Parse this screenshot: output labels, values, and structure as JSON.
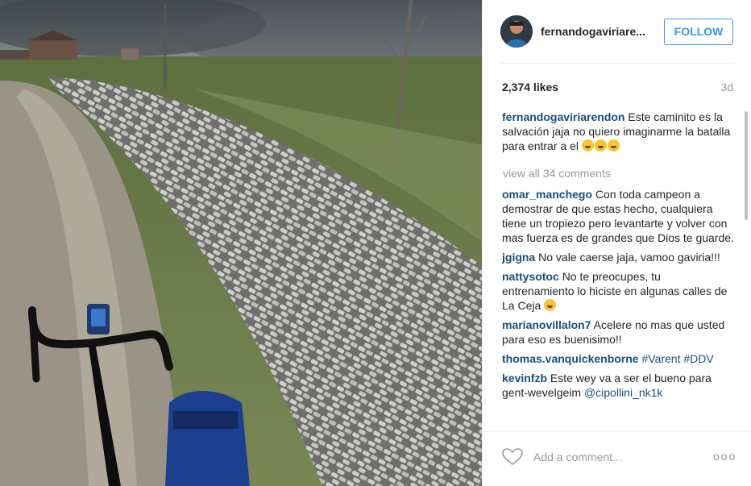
{
  "post": {
    "username": "fernandogaviriare...",
    "follow_label": "FOLLOW",
    "likes": "2,374 likes",
    "age": "3d",
    "view_all": "view all 34 comments",
    "add_comment_placeholder": "Add a comment...",
    "more_label": "ooo"
  },
  "caption": {
    "user": "fernandogaviriarendon",
    "text": "Este caminito es la salvación jaja no quiero imaginarme la batalla para entrar a el",
    "emoji": "tears-of-joy-emoji x3"
  },
  "comments": [
    {
      "user": "omar_manchego",
      "text": "Con toda campeon a demostrar de que estas hecho, cualquiera tiene un tropiezo pero levantarte y volver con mas fuerza es de grandes que Dios te guarde."
    },
    {
      "user": "jgigna",
      "text": "No vale caerse jaja, vamoo gaviria!!!"
    },
    {
      "user": "nattysotoc",
      "text": "No te preocupes, tu entrenamiento lo hiciste en algunas calles de La Ceja"
    },
    {
      "user": "marianovillalon7",
      "text": "Acelere no mas que usted para eso es buenisimo!!"
    },
    {
      "user": "thomas.vanquickenborne",
      "text": "#Varent #DDV"
    },
    {
      "user": "kevinfzb",
      "text": "Este wey va a ser el bueno para gent-wevelgeim",
      "mention": "@cipollini_nk1k"
    }
  ],
  "colors": {
    "link": "#1b4e7a",
    "follow_blue": "#3897f0",
    "muted": "#999999",
    "emoji_yellow": "#f7c52e"
  }
}
